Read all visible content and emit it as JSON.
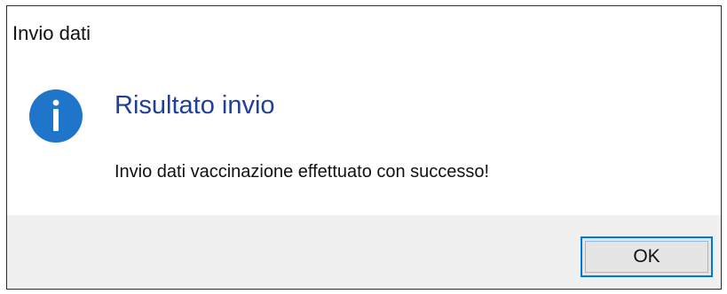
{
  "dialog": {
    "title": "Invio dati",
    "heading": "Risultato invio",
    "message": "Invio dati vaccinazione effettuato con successo!",
    "icon": "information-icon",
    "ok_label": "OK"
  },
  "colors": {
    "heading": "#1f3f9a",
    "icon_fill": "#1f75c9",
    "button_border": "#0078d7",
    "footer_background": "#f0f0f0"
  }
}
